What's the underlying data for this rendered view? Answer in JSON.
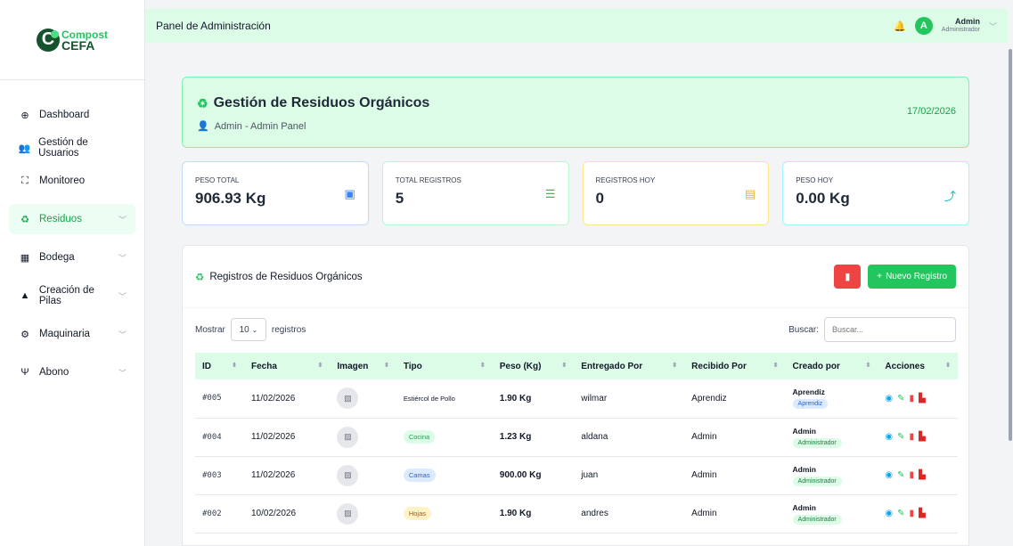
{
  "logo": {
    "line1": "Compost",
    "line2": "CEFA"
  },
  "sidebar": {
    "items": [
      {
        "label": "Dashboard",
        "icon": "globe-icon",
        "glyph": "⊕",
        "chevron": false
      },
      {
        "label": "Gestión de Usuarios",
        "icon": "users-icon",
        "glyph": "👥",
        "chevron": false
      },
      {
        "label": "Monitoreo",
        "icon": "chart-line-icon",
        "glyph": "⛶",
        "chevron": false
      },
      {
        "label": "Residuos",
        "icon": "recycle-icon",
        "glyph": "♻",
        "chevron": true,
        "active": true
      },
      {
        "label": "Bodega",
        "icon": "warehouse-icon",
        "glyph": "▦",
        "chevron": true
      },
      {
        "label": "Creación de Pilas",
        "icon": "mountain-icon",
        "glyph": "▲",
        "chevron": true
      },
      {
        "label": "Maquinaria",
        "icon": "cogs-icon",
        "glyph": "⚙",
        "chevron": true
      },
      {
        "label": "Abono",
        "icon": "seedling-icon",
        "glyph": "Ψ",
        "chevron": true
      }
    ]
  },
  "topbar": {
    "title": "Panel de Administración",
    "user_name": "Admin",
    "user_role": "Administrador",
    "avatar_letter": "A"
  },
  "hero": {
    "title": "Gestión de Residuos Orgánicos",
    "subtitle": "Admin - Admin Panel",
    "date": "17/02/2026"
  },
  "stats": [
    {
      "label": "PESO TOTAL",
      "value": "906.93 Kg",
      "icon": "weight-icon",
      "glyph": "▣",
      "color": "#3b82f6"
    },
    {
      "label": "TOTAL REGISTROS",
      "value": "5",
      "icon": "list-icon",
      "glyph": "☰",
      "color": "#22c55e"
    },
    {
      "label": "REGISTROS HOY",
      "value": "0",
      "icon": "calendar-icon",
      "glyph": "▤",
      "color": "#eab308"
    },
    {
      "label": "PESO HOY",
      "value": "0.00 Kg",
      "icon": "chart-line-icon",
      "glyph": "⤴",
      "color": "#06b6d4"
    }
  ],
  "panel": {
    "title": "Registros de Residuos Orgánicos",
    "new_label": "Nuevo Registro"
  },
  "controls": {
    "show": "Mostrar",
    "page_size": "10",
    "records": "registros",
    "search_label": "Buscar:",
    "search_placeholder": "Buscar..."
  },
  "table": {
    "headers": [
      "ID",
      "Fecha",
      "Imagen",
      "Tipo",
      "Peso (Kg)",
      "Entregado Por",
      "Recibido Por",
      "Creado por",
      "Acciones"
    ],
    "rows": [
      {
        "id": "#005",
        "fecha": "11/02/2026",
        "tipo": "Estiércol de Pollo",
        "tipo_style": "plain",
        "peso": "1.90 Kg",
        "entregado": "wilmar",
        "recibido": "Aprendiz",
        "creado": "Aprendiz",
        "rol": "Aprendiz",
        "rol_style": "apr"
      },
      {
        "id": "#004",
        "fecha": "11/02/2026",
        "tipo": "Cocina",
        "tipo_style": "green",
        "peso": "1.23 Kg",
        "entregado": "aldana",
        "recibido": "Admin",
        "creado": "Admin",
        "rol": "Administrador",
        "rol_style": "adm"
      },
      {
        "id": "#003",
        "fecha": "11/02/2026",
        "tipo": "Camas",
        "tipo_style": "blue",
        "peso": "900.00 Kg",
        "entregado": "juan",
        "recibido": "Admin",
        "creado": "Admin",
        "rol": "Administrador",
        "rol_style": "adm"
      },
      {
        "id": "#002",
        "fecha": "10/02/2026",
        "tipo": "Hojas",
        "tipo_style": "yellow",
        "peso": "1.90 Kg",
        "entregado": "andres",
        "recibido": "Admin",
        "creado": "Admin",
        "rol": "Administrador",
        "rol_style": "adm"
      }
    ]
  }
}
